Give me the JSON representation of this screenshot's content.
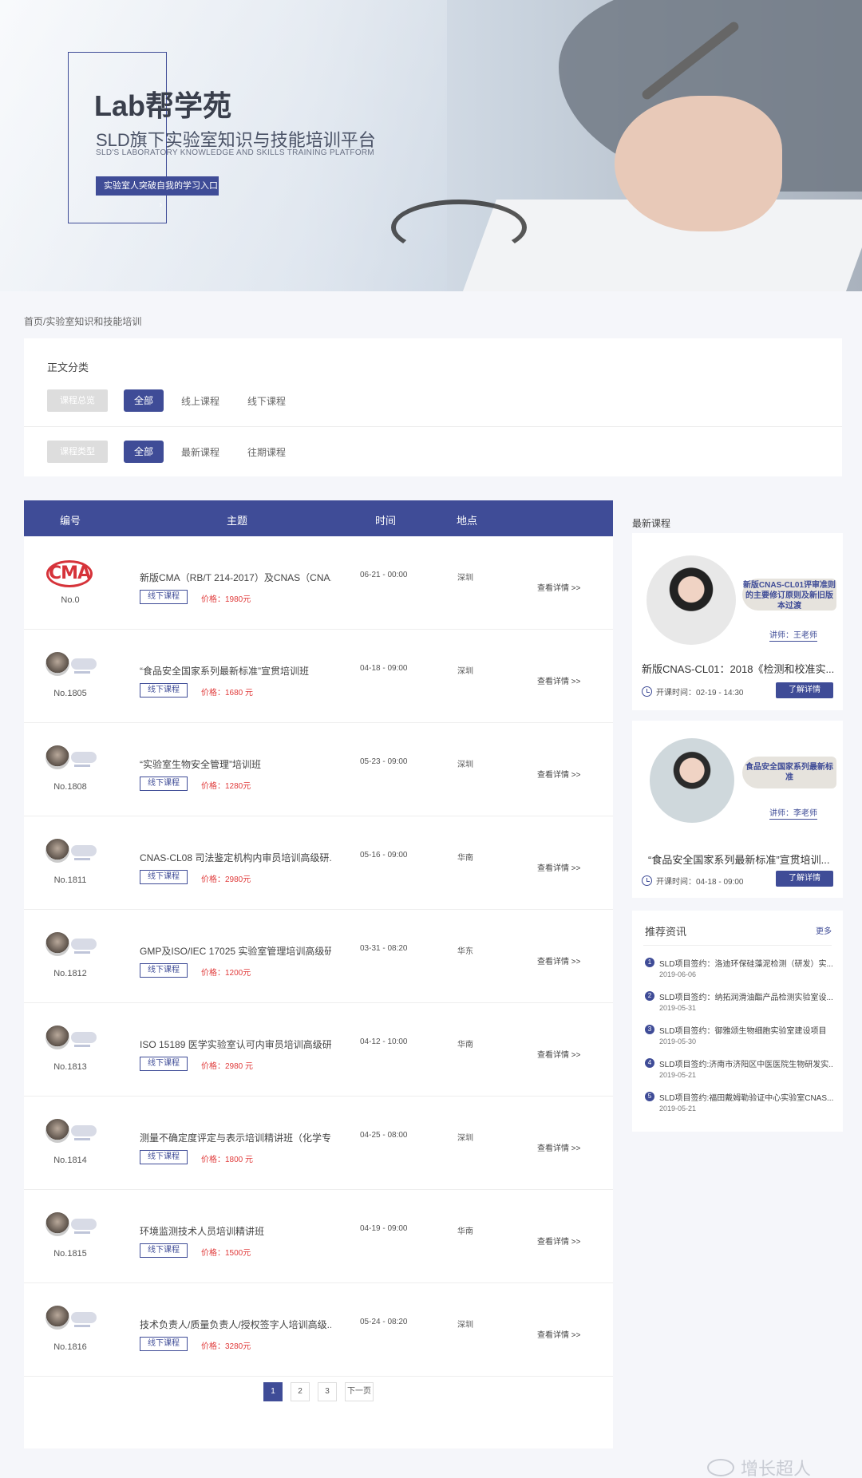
{
  "hero": {
    "title": "Lab帮学苑",
    "subtitle": "SLD旗下实验室知识与技能培训平台",
    "subtitle_en": "SLD'S LABORATORY KNOWLEDGE AND SKILLS TRAINING PLATFORM",
    "cta_label": "实验室人突破自我的学习入口 ›"
  },
  "breadcrumb": "首页/实验室知识和技能培训",
  "filters": {
    "heading": "正文分类",
    "rows": [
      {
        "tag": "课程总览",
        "options": [
          "全部",
          "线上课程",
          "线下课程"
        ],
        "active": 0
      },
      {
        "tag": "课程类型",
        "options": [
          "全部",
          "最新课程",
          "往期课程"
        ],
        "active": 0
      }
    ]
  },
  "table": {
    "headers": {
      "num": "编号",
      "topic": "主题",
      "time": "时间",
      "location": "地点"
    },
    "detail_label": "查看详情 >>",
    "rows": [
      {
        "num": "No.0",
        "topic": "新版CMA（RB/T 214-2017）及CNAS（CNA...",
        "badge": "线下课程",
        "price": "价格：1980元",
        "time": "06-21 - 00:00",
        "location": "深圳",
        "logo": "CMA"
      },
      {
        "num": "No.1805",
        "topic": "“食品安全国家系列最新标准”宣贯培训班",
        "badge": "线下课程",
        "price": "价格：1680 元",
        "time": "04-18 - 09:00",
        "location": "深圳",
        "logo": ""
      },
      {
        "num": "No.1808",
        "topic": "“实验室生物安全管理”培训班",
        "badge": "线下课程",
        "price": "价格：1280元",
        "time": "05-23 - 09:00",
        "location": "深圳",
        "logo": ""
      },
      {
        "num": "No.1811",
        "topic": "CNAS-CL08 司法鉴定机构内审员培训高级研...",
        "badge": "线下课程",
        "price": "价格：2980元",
        "time": "05-16 - 09:00",
        "location": "华南",
        "logo": ""
      },
      {
        "num": "No.1812",
        "topic": "GMP及ISO/IEC 17025 实验室管理培训高级研...",
        "badge": "线下课程",
        "price": "价格：1200元",
        "time": "03-31 - 08:20",
        "location": "华东",
        "logo": ""
      },
      {
        "num": "No.1813",
        "topic": "ISO 15189 医学实验室认可内审员培训高级研...",
        "badge": "线下课程",
        "price": "价格：2980 元",
        "time": "04-12 - 10:00",
        "location": "华南",
        "logo": ""
      },
      {
        "num": "No.1814",
        "topic": "测量不确定度评定与表示培训精讲班（化学专...",
        "badge": "线下课程",
        "price": "价格：1800 元",
        "time": "04-25 - 08:00",
        "location": "深圳",
        "logo": ""
      },
      {
        "num": "No.1815",
        "topic": "环境监测技术人员培训精讲班",
        "badge": "线下课程",
        "price": "价格：1500元",
        "time": "04-19 - 09:00",
        "location": "华南",
        "logo": ""
      },
      {
        "num": "No.1816",
        "topic": "技术负责人/质量负责人/授权签字人培训高级...",
        "badge": "线下课程",
        "price": "价格：3280元",
        "time": "05-24 - 08:20",
        "location": "深圳",
        "logo": ""
      }
    ]
  },
  "pagination": {
    "pages": [
      "1",
      "2",
      "3"
    ],
    "next": "下一页",
    "active": 0
  },
  "sidebar": {
    "latest_title": "最新课程",
    "courses": [
      {
        "pill": "新版CNAS-CL01评审准则的主要修订原则及新旧版本过渡",
        "teacher": "讲师：王老师",
        "title": "新版CNAS-CL01：2018《检测和校准实...",
        "time": "开课时间：02-19 - 14:30",
        "button": "了解详情"
      },
      {
        "pill": "食品安全国家系列最新标准",
        "teacher": "讲师：李老师",
        "title": "“食品安全国家系列最新标准”宣贯培训...",
        "time": "开课时间：04-18 - 09:00",
        "button": "了解详情"
      }
    ],
    "news": {
      "title": "推荐资讯",
      "more": "更多",
      "items": [
        {
          "n": "1",
          "text": "SLD项目签约：洛迪环保硅藻泥检测（研发）实...",
          "date": "2019-06-06"
        },
        {
          "n": "2",
          "text": "SLD项目签约：纳拓润滑油酯产品检测实验室设...",
          "date": "2019-05-31"
        },
        {
          "n": "3",
          "text": "SLD项目签约：御雅颂生物细胞实验室建设项目",
          "date": "2019-05-30"
        },
        {
          "n": "4",
          "text": "SLD项目签约:济南市济阳区中医医院生物研发实...",
          "date": "2019-05-21"
        },
        {
          "n": "5",
          "text": "SLD项目签约:福田戴姆勒验证中心实验室CNAS...",
          "date": "2019-05-21"
        }
      ]
    }
  },
  "watermark": "增长超人"
}
